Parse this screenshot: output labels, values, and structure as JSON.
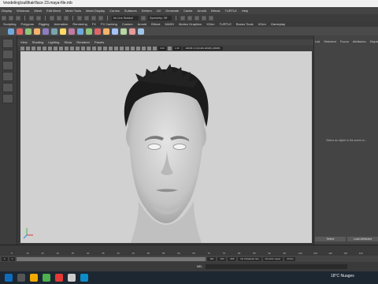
{
  "window": {
    "title": "\\modeling\\sullihair\\face 23.maya-file.mb"
  },
  "menus": [
    "Display",
    "Windows",
    "Mesh",
    "Edit Mesh",
    "Mesh Tools",
    "Mesh Display",
    "Curves",
    "Surfaces",
    "Deform",
    "UV",
    "Generate",
    "Cache",
    "Arnold",
    "Bifrost",
    "TURTLE",
    "Help"
  ],
  "toolbar": {
    "selection_field": "No Live Surface",
    "symmetry": "Symmetry: Off"
  },
  "shelf_tabs": [
    "Sculpting",
    "Polygons",
    "Rigging",
    "Animation",
    "Rendering",
    "FX",
    "FX Caching",
    "Custom",
    "Arnold",
    "Bifrost",
    "MASH",
    "Motion Graphics",
    "XGen",
    "TURTLE",
    "Bonus Tools",
    "XGen",
    "Gameplay"
  ],
  "shelf_active_tab": "XGen",
  "shelf_colors": [
    "#6fa8dc",
    "#e06666",
    "#93c47d",
    "#f6b26b",
    "#8e7cc3",
    "#76a5af",
    "#ffd966",
    "#c27ba0",
    "#6fa8dc",
    "#93c47d",
    "#e06666",
    "#f6b26b",
    "#a4c2f4",
    "#b6d7a8",
    "#ea9999",
    "#9fc5e8"
  ],
  "panel_menu": [
    "View",
    "Shading",
    "Lighting",
    "Show",
    "Renderer",
    "Panels"
  ],
  "panel_toolbar": {
    "value_a": "0.00",
    "value_b": "1.00",
    "color_management": "sRGB 1.0 (ACES sRGB) (sRGB)"
  },
  "right_tabs": [
    "List",
    "Selected",
    "Focus",
    "Attributes",
    "Display"
  ],
  "attribute_editor": {
    "empty_message": "Select an object in the scene to..."
  },
  "right_buttons": [
    "Select",
    "Load Attributes"
  ],
  "timeslider": {
    "ticks": [
      "5",
      "10",
      "15",
      "20",
      "25",
      "30",
      "35",
      "40",
      "45",
      "50",
      "55",
      "60",
      "65",
      "70",
      "75",
      "80",
      "85",
      "90",
      "95",
      "100",
      "105",
      "110",
      "115",
      "120"
    ]
  },
  "range": {
    "start": "1",
    "start_inner": "1",
    "end_inner": "120",
    "end": "120",
    "end2": "200",
    "character_set": "No Character Set",
    "anim_layer": "No Anim Layer",
    "fps": "24 fps"
  },
  "command": {
    "label": "MEL"
  },
  "taskbar": {
    "weather": "18°C  Nuages",
    "time": ""
  }
}
